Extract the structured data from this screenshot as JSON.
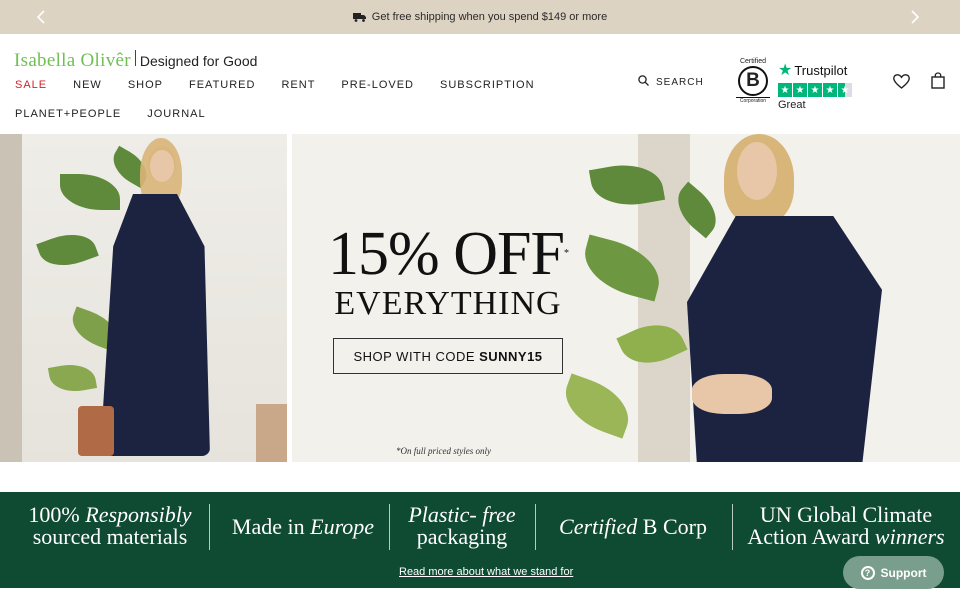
{
  "announcement": {
    "text": "Get free shipping when you spend $149 or more",
    "prev_icon": "chevron-left-icon",
    "next_icon": "chevron-right-icon"
  },
  "header": {
    "brand": "Isabella Olivêr",
    "tagline": "Designed for Good",
    "nav_row1": [
      "SALE",
      "NEW",
      "SHOP",
      "FEATURED",
      "RENT",
      "PRE-LOVED",
      "SUBSCRIPTION"
    ],
    "nav_row2": [
      "PLANET+PEOPLE",
      "JOURNAL"
    ],
    "search_label": "SEARCH",
    "bcorp_certified": "Certified",
    "bcorp_letter": "B",
    "bcorp_corporation": "Corporation",
    "trustpilot_name": "Trustpilot",
    "trustpilot_rating": "Great",
    "trustpilot_stars": 4.5
  },
  "hero": {
    "discount": "15% OFF",
    "discount_mark": "*",
    "everything": "EVERYTHING",
    "code_prefix": "SHOP WITH CODE",
    "code": "SUNNY15",
    "fine_print": "*On full priced styles only"
  },
  "values": {
    "v1_a": "100%",
    "v1_b": "Responsibly",
    "v1_c": "sourced materials",
    "v2_a": "Made in",
    "v2_b": "Europe",
    "v3_a": "Plastic- free",
    "v3_b": "packaging",
    "v4_a": "Certified",
    "v4_b": "B Corp",
    "v5_a": "UN Global Climate",
    "v5_b": "Action Award",
    "v5_c": "winners",
    "link": "Read more about what we stand for"
  },
  "support": {
    "label": "Support"
  },
  "colors": {
    "announce_bg": "#ddd3c2",
    "brand_green": "#6fbf52",
    "sale_red": "#d0232a",
    "values_bg": "#0f4a33",
    "trustpilot_green": "#00b67a",
    "support_bg": "#7a9e8d"
  }
}
